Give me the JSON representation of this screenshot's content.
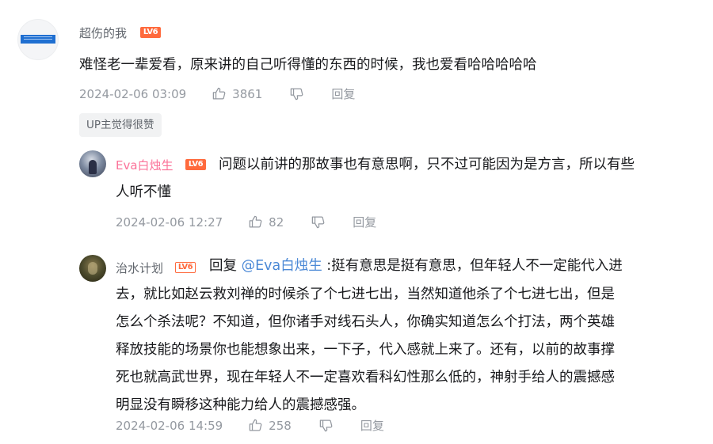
{
  "level_label": "LV6",
  "comments": [
    {
      "user": "超伤的我",
      "level": "LV6",
      "lines": [
        "难怪老一辈爱看，原来讲的自己听得懂的东西的时候，我也爱看哈哈哈哈哈"
      ],
      "time": "2024-02-06 03:09",
      "likes": "3861",
      "reply_label": "回复",
      "badge": "UP主觉得很赞"
    },
    {
      "user": "Eva白烛生",
      "level": "LV6",
      "lines": [
        "问题以前讲的那故事也有意思啊，只不过可能因为是方言，所以有些",
        "人听不懂"
      ],
      "time": "2024-02-06 12:27",
      "likes": "82",
      "reply_label": "回复"
    },
    {
      "user": "治水计划",
      "level": "LV6",
      "reply_prefix": "回复",
      "mention": "@Eva白烛生",
      "first_line_rest": ":挺有意思是挺有意思，但年轻人不一定能代入进",
      "lines": [
        "去，就比如赵云救刘禅的时候杀了个七进七出，当然知道他杀了个七进七出，但是",
        "怎么个杀法呢？不知道，但你诸手对线石头人，你确实知道怎么个打法，两个英雄",
        "释放技能的场景你也能想象出来，一下子，代入感就上来了。还有，以前的故事撑",
        "死也就高武世界，现在年轻人不一定喜欢看科幻性那么低的，神射手给人的震撼感",
        "明显没有瞬移这种能力给人的震撼感强。"
      ],
      "time": "2024-02-06 14:59",
      "likes": "258",
      "reply_label": "回复"
    }
  ],
  "colors": {
    "username_default": "#61666d",
    "username_vip": "#fb7299",
    "mention": "#4b89d6",
    "level_badge": "#ff6a3d",
    "meta": "#9499a0"
  },
  "icons": [
    "thumb-up-icon",
    "thumb-down-icon"
  ]
}
